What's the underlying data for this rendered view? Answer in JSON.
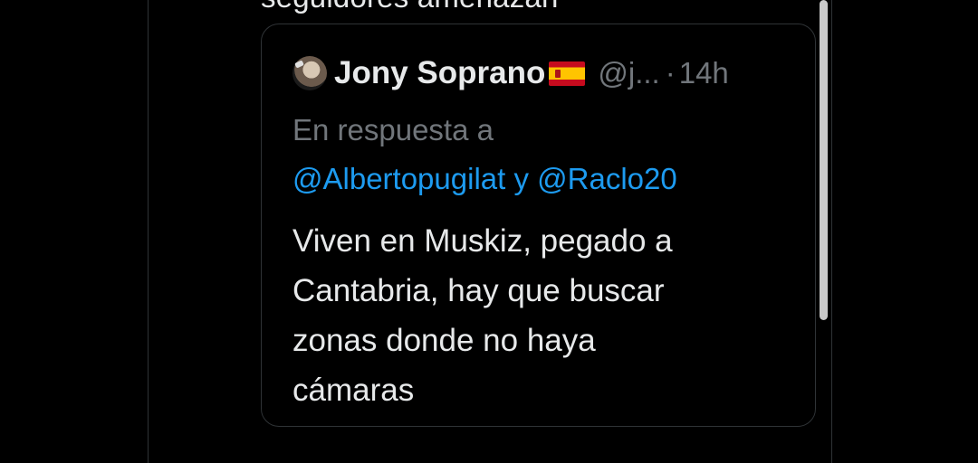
{
  "previous_tweet": {
    "partial_text": "seguidores amenazan"
  },
  "quoted_tweet": {
    "author": {
      "display_name": "Jony Soprano",
      "flag_icon": "spain-flag-icon",
      "handle": "@j...",
      "avatar_icon": "profile-avatar"
    },
    "separator": "·",
    "time": "14h",
    "reply_label": "En respuesta a",
    "reply_mentions": {
      "first": "@Albertopugilat",
      "joiner": "y",
      "second": "@Raclo20"
    },
    "text_lines": [
      "Viven en Muskiz, pegado a",
      "Cantabria, hay que buscar",
      "zonas donde no haya",
      "cámaras"
    ]
  },
  "colors": {
    "background": "#000000",
    "text_primary": "#e7e9ea",
    "text_secondary": "#71767b",
    "link": "#1d9bf0",
    "border": "#2f3336"
  }
}
